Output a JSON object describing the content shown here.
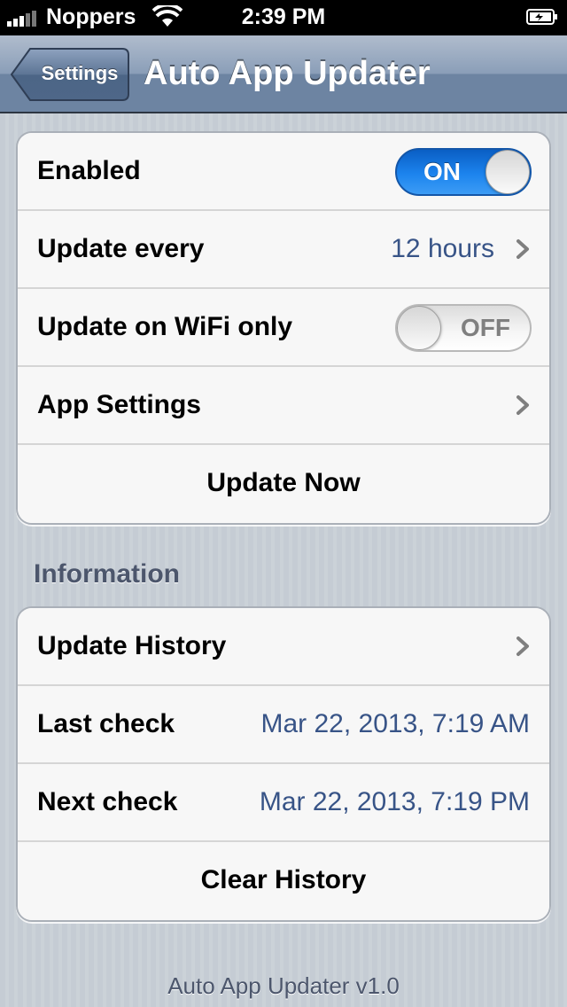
{
  "status_bar": {
    "carrier": "Noppers",
    "time": "2:39 PM",
    "icons": [
      "signal-icon",
      "wifi-icon",
      "battery-charging-icon"
    ]
  },
  "nav": {
    "back_label": "Settings",
    "title": "Auto App Updater"
  },
  "main_group": {
    "enabled_label": "Enabled",
    "enabled_switch": "ON",
    "update_every_label": "Update every",
    "update_every_value": "12 hours",
    "wifi_only_label": "Update on WiFi only",
    "wifi_only_switch": "OFF",
    "app_settings_label": "App Settings",
    "update_now_label": "Update Now"
  },
  "info_group": {
    "header": "Information",
    "update_history_label": "Update History",
    "last_check_label": "Last check",
    "last_check_value": "Mar 22, 2013, 7:19 AM",
    "next_check_label": "Next check",
    "next_check_value": "Mar 22, 2013, 7:19 PM",
    "clear_history_label": "Clear History"
  },
  "footer": "Auto App Updater v1.0",
  "colors": {
    "nav_bar": "#6d84a2",
    "value_text": "#385487",
    "switch_on": "#1c84ee",
    "background": "#c5ccd4"
  }
}
